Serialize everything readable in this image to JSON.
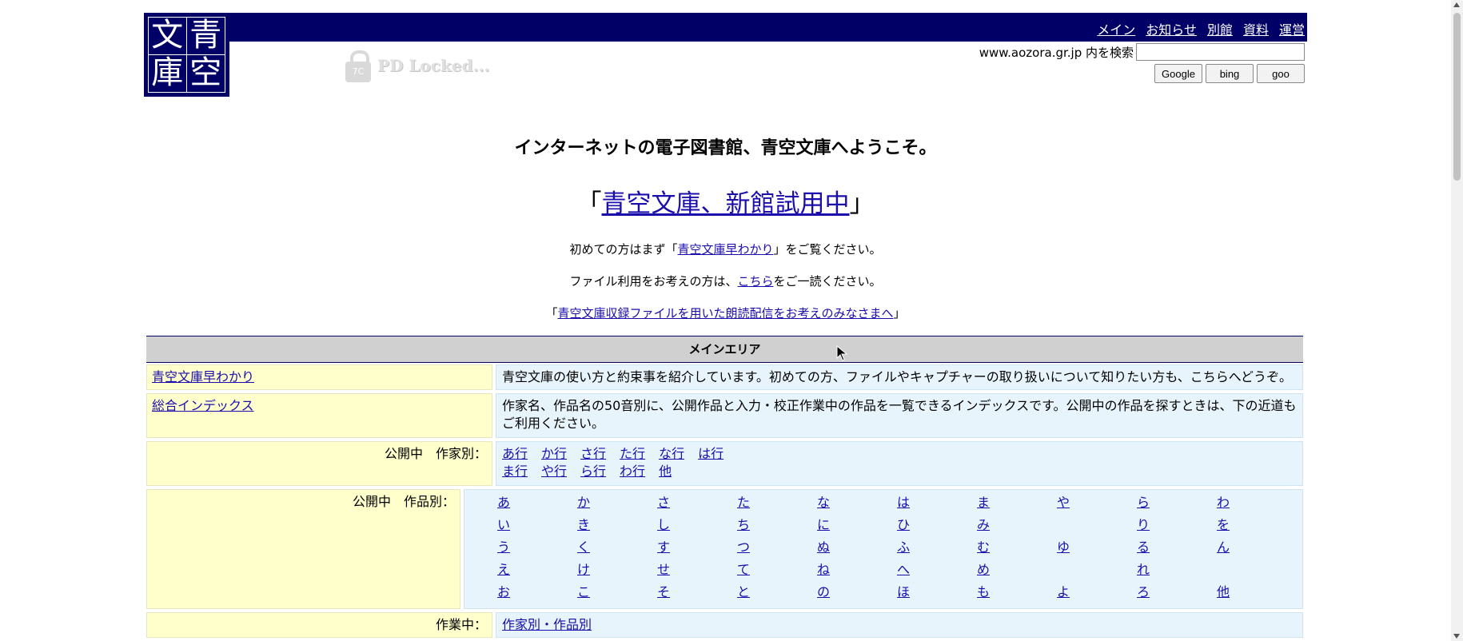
{
  "logo": {
    "chars": [
      "文",
      "青",
      "庫",
      "空"
    ]
  },
  "topnav": [
    "メイン",
    "お知らせ",
    "別館",
    "資料",
    "運営"
  ],
  "pdlock": {
    "icon": "lock-icon",
    "badge": "7C",
    "text": "PD Locked..."
  },
  "search": {
    "label": "www.aozora.gr.jp 内を検索",
    "value": "",
    "buttons": [
      "Google",
      "bing",
      "goo"
    ]
  },
  "welcome": "インターネットの電子図書館、青空文庫へようこそ。",
  "feature": {
    "open": "「",
    "link": "青空文庫、新館試用中",
    "close": "」"
  },
  "lines": {
    "l1_pre": "初めての方はまず「",
    "l1_link": "青空文庫早わかり",
    "l1_post": "」をご覧ください。",
    "l2_pre": "ファイル利用をお考えの方は、",
    "l2_link": "こちら",
    "l2_post": "をご一読ください。",
    "l3_pre": "「",
    "l3_link": "青空文庫収録ファイルを用いた朗読配信をお考えのみなさまへ",
    "l3_post": "」"
  },
  "main_area": {
    "title": "メインエリア",
    "rows": [
      {
        "left_link": "青空文庫早わかり",
        "right": "青空文庫の使い方と約束事を紹介しています。初めての方、ファイルやキャプチャーの取り扱いについて知りたい方も、こちらへどうぞ。"
      },
      {
        "left_link": "総合インデックス",
        "right": "作家名、作品名の50音別に、公開作品と入力・校正作業中の作品を一覧できるインデックスです。公開中の作品を探すときは、下の近道もご利用ください。"
      }
    ],
    "by_author": {
      "label": "公開中　作家別：",
      "line1": [
        "あ行",
        "か行",
        "さ行",
        "た行",
        "な行",
        "は行"
      ],
      "line2": [
        "ま行",
        "や行",
        "ら行",
        "わ行",
        "他"
      ]
    },
    "by_title": {
      "label": "公開中　作品別：",
      "grid": [
        [
          "あ",
          "か",
          "さ",
          "た",
          "な",
          "は",
          "ま",
          "や",
          "ら",
          "わ"
        ],
        [
          "い",
          "き",
          "し",
          "ち",
          "に",
          "ひ",
          "み",
          "",
          "り",
          "を"
        ],
        [
          "う",
          "く",
          "す",
          "つ",
          "ぬ",
          "ふ",
          "む",
          "ゆ",
          "る",
          "ん"
        ],
        [
          "え",
          "け",
          "せ",
          "て",
          "ね",
          "へ",
          "め",
          "",
          "れ",
          ""
        ],
        [
          "お",
          "こ",
          "そ",
          "と",
          "の",
          "ほ",
          "も",
          "よ",
          "ろ",
          "他"
        ]
      ]
    },
    "in_progress": {
      "label": "作業中：",
      "link": "作家別・作品別"
    }
  }
}
